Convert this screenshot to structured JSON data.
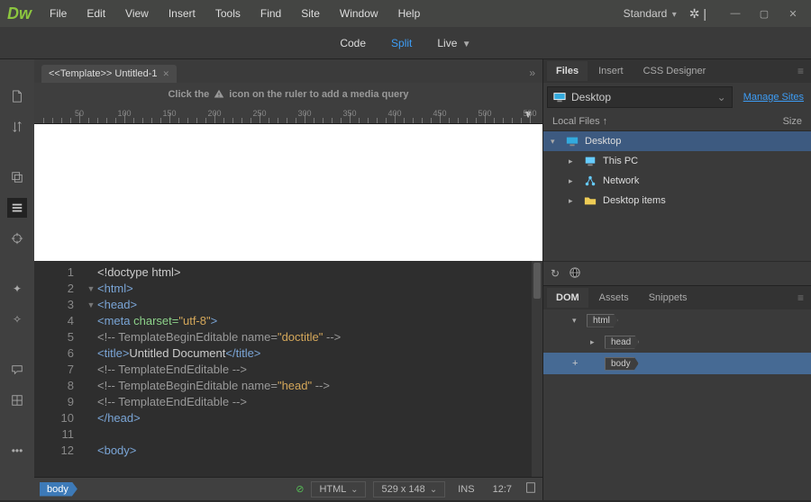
{
  "app": {
    "logo": "Dw"
  },
  "menu": {
    "items": [
      "File",
      "Edit",
      "View",
      "Insert",
      "Tools",
      "Find",
      "Site",
      "Window",
      "Help"
    ]
  },
  "workspace": {
    "label": "Standard"
  },
  "viewmodes": {
    "code": "Code",
    "split": "Split",
    "live": "Live"
  },
  "doc": {
    "tab": "<<Template>> Untitled-1"
  },
  "hint": {
    "pre": "Click the",
    "post": "icon on the ruler to add a media query"
  },
  "ruler": {
    "ticks": [
      "50",
      "100",
      "150",
      "200",
      "250",
      "300",
      "350",
      "400",
      "450",
      "500",
      "550"
    ]
  },
  "code": {
    "lines": [
      {
        "n": "1",
        "fold": "",
        "html": "<span class='c-txt'>&lt;!doctype html&gt;</span>"
      },
      {
        "n": "2",
        "fold": "▼",
        "html": "<span class='c-tag'>&lt;html&gt;</span>"
      },
      {
        "n": "3",
        "fold": "▼",
        "html": "<span class='c-tag'>&lt;head&gt;</span>"
      },
      {
        "n": "4",
        "fold": "",
        "html": "<span class='c-tag'>&lt;meta</span> <span class='c-attr'>charset=</span><span class='c-str'>\"utf-8\"</span><span class='c-tag'>&gt;</span>"
      },
      {
        "n": "5",
        "fold": "",
        "html": "<span class='c-com'>&lt;!-- TemplateBeginEditable name=</span><span class='c-str'>\"doctitle\"</span><span class='c-com'> --&gt;</span>"
      },
      {
        "n": "6",
        "fold": "",
        "html": "<span class='c-tag'>&lt;title&gt;</span><span class='c-txt'>Untitled Document</span><span class='c-tag'>&lt;/title&gt;</span>"
      },
      {
        "n": "7",
        "fold": "",
        "html": "<span class='c-com'>&lt;!-- TemplateEndEditable --&gt;</span>"
      },
      {
        "n": "8",
        "fold": "",
        "html": "<span class='c-com'>&lt;!-- TemplateBeginEditable name=</span><span class='c-str'>\"head\"</span><span class='c-com'> --&gt;</span>"
      },
      {
        "n": "9",
        "fold": "",
        "html": "<span class='c-com'>&lt;!-- TemplateEndEditable --&gt;</span>"
      },
      {
        "n": "10",
        "fold": "",
        "html": "<span class='c-tag'>&lt;/head&gt;</span>"
      },
      {
        "n": "11",
        "fold": "",
        "html": ""
      },
      {
        "n": "12",
        "fold": "",
        "html": "<span class='c-tag'>&lt;body&gt;</span>"
      }
    ]
  },
  "status": {
    "breadcrumb": "body",
    "lang": "HTML",
    "size": "529 x 148",
    "ins": "INS",
    "pos": "12:7"
  },
  "panels": {
    "files": {
      "tabs": [
        "Files",
        "Insert",
        "CSS Designer"
      ],
      "site": "Desktop",
      "manage": "Manage Sites",
      "col1": "Local Files ↑",
      "col2": "Size",
      "tree": [
        {
          "indent": 0,
          "arrow": "▾",
          "icon": "monitor",
          "label": "Desktop",
          "sel": true
        },
        {
          "indent": 1,
          "arrow": "▸",
          "icon": "pc",
          "label": "This PC",
          "sel": false
        },
        {
          "indent": 1,
          "arrow": "▸",
          "icon": "net",
          "label": "Network",
          "sel": false
        },
        {
          "indent": 1,
          "arrow": "▸",
          "icon": "folder",
          "label": "Desktop items",
          "sel": false
        }
      ]
    },
    "dom": {
      "tabs": [
        "DOM",
        "Assets",
        "Snippets"
      ],
      "rows": [
        {
          "indent": 0,
          "arrow": "▾",
          "tag": "html",
          "sel": false,
          "add": false
        },
        {
          "indent": 1,
          "arrow": "▸",
          "tag": "head",
          "sel": false,
          "add": false
        },
        {
          "indent": 1,
          "arrow": "",
          "tag": "body",
          "sel": true,
          "add": true
        }
      ]
    }
  }
}
